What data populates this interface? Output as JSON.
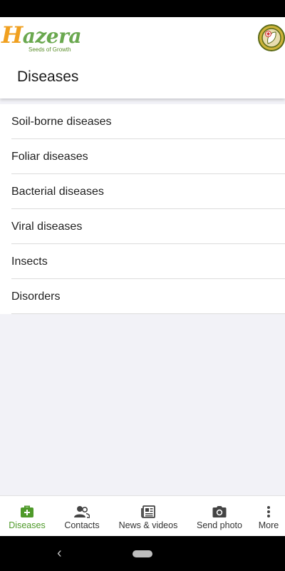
{
  "brand": {
    "name": "azera",
    "initial": "H",
    "tagline": "Seeds of Growth"
  },
  "page": {
    "title": "Diseases"
  },
  "categories": [
    {
      "label": "Soil-borne diseases"
    },
    {
      "label": "Foliar diseases"
    },
    {
      "label": "Bacterial diseases"
    },
    {
      "label": "Viral diseases"
    },
    {
      "label": "Insects"
    },
    {
      "label": "Disorders"
    }
  ],
  "bottom_nav": [
    {
      "label": "Diseases",
      "icon": "first-aid-kit-icon",
      "active": true
    },
    {
      "label": "Contacts",
      "icon": "people-icon",
      "active": false
    },
    {
      "label": "News & videos",
      "icon": "newspaper-icon",
      "active": false
    },
    {
      "label": "Send photo",
      "icon": "camera-icon",
      "active": false
    },
    {
      "label": "More",
      "icon": "more-vertical-icon",
      "active": false
    }
  ],
  "colors": {
    "brand_green": "#6aa84f",
    "brand_orange": "#f0a020",
    "active_nav": "#4f9a2a",
    "background": "#f2f2f7"
  }
}
